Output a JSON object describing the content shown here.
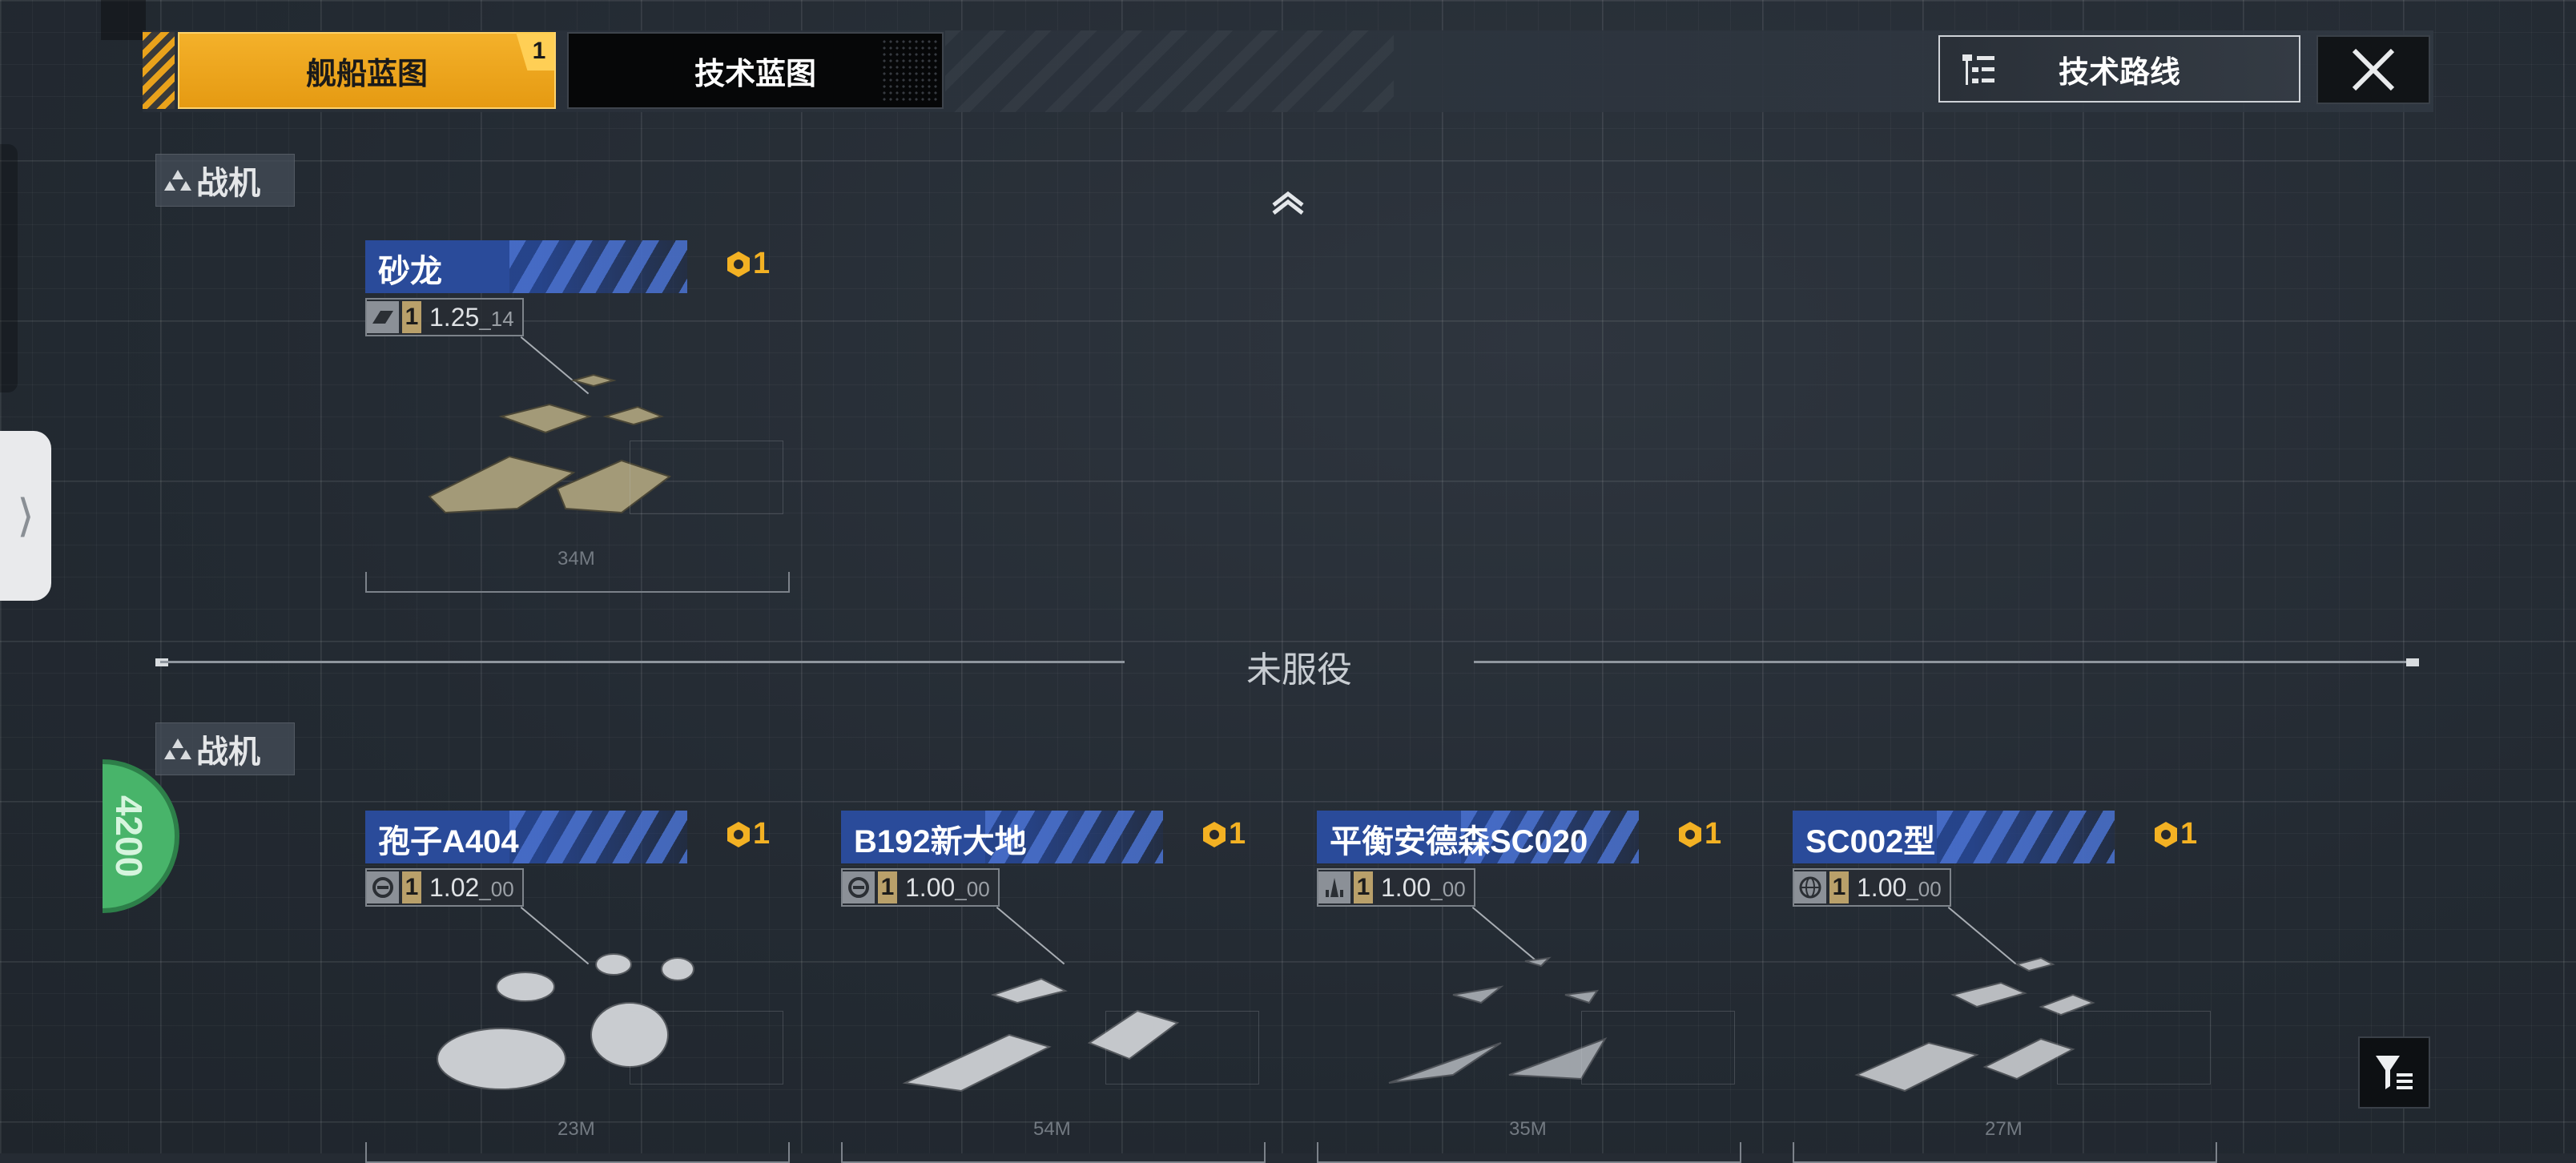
{
  "tabs": {
    "ship_blueprint": "舰船蓝图",
    "ship_blueprint_badge": "1",
    "tech_blueprint": "技术蓝图"
  },
  "header": {
    "tech_route": "技术路线",
    "close_icon": "close-x-icon"
  },
  "sections": {
    "active_fighter": "战机",
    "inactive_fighter": "战机",
    "divider": "未服役"
  },
  "active_cards": [
    {
      "name": "砂龙",
      "cost": "1",
      "level": "1",
      "ratio": "1.25",
      "ratio_sub": "14",
      "length": "34M"
    }
  ],
  "inactive_cards": [
    {
      "name": "孢子A404",
      "cost": "1",
      "level": "1",
      "ratio": "1.02",
      "ratio_sub": "00",
      "length": "23M"
    },
    {
      "name": "B192新大地",
      "cost": "1",
      "level": "1",
      "ratio": "1.00",
      "ratio_sub": "00",
      "length": "54M"
    },
    {
      "name": "平衡安德森SC020",
      "cost": "1",
      "level": "1",
      "ratio": "1.00",
      "ratio_sub": "00",
      "length": "35M"
    },
    {
      "name": "SC002型",
      "cost": "1",
      "level": "1",
      "ratio": "1.00",
      "ratio_sub": "00",
      "length": "27M"
    }
  ],
  "green_badge": "4200",
  "colors": {
    "accent_orange": "#f3b123",
    "name_bar_blue": "#2a4b9a",
    "green_badge": "#48b46a"
  }
}
